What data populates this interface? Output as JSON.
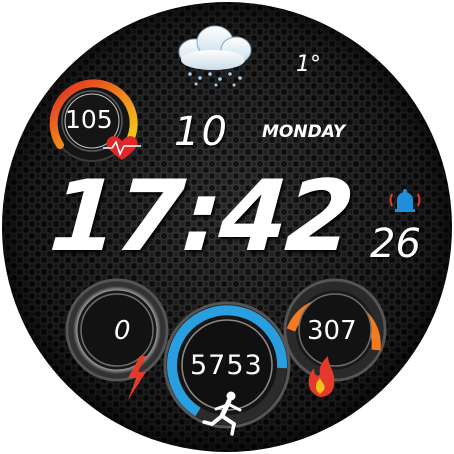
{
  "watch_face": {
    "time": {
      "hours_minutes": "17:42",
      "seconds": "26"
    },
    "date": {
      "day": "10",
      "weekday": "MONDAY"
    },
    "weather": {
      "temperature": "1°",
      "icon": "snow-cloud-icon"
    },
    "heart_rate": {
      "value": "105",
      "icon": "heart-pulse-icon"
    },
    "alarm": {
      "icon": "alarm-bell-icon"
    },
    "gauges": {
      "left": {
        "value": "0",
        "icon": "lightning-icon"
      },
      "center": {
        "value": "5753",
        "icon": "runner-icon"
      },
      "right": {
        "value": "307",
        "icon": "flame-icon"
      }
    }
  },
  "colors": {
    "accent_blue": "#2a9fdf",
    "accent_orange": "#f47a1f",
    "heart_red": "#e02626",
    "ring_yellow": "#f2c21b",
    "icon_red": "#e33a2b"
  }
}
